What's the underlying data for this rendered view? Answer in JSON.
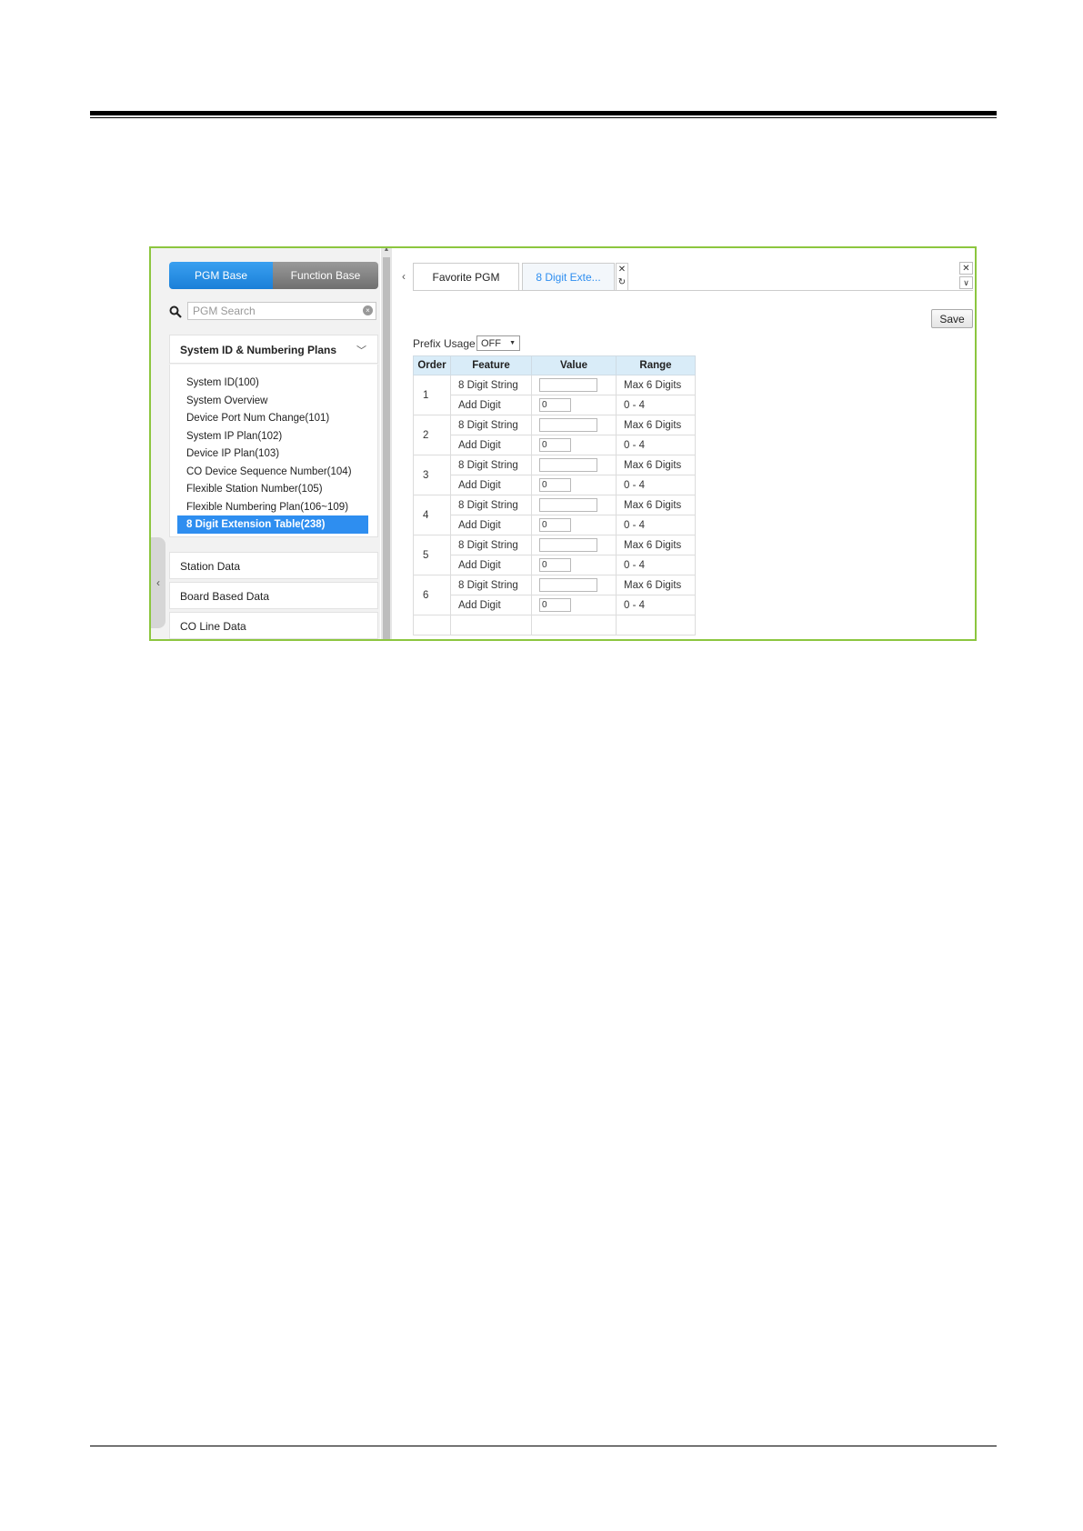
{
  "left_panel": {
    "toggle": {
      "active": "PGM Base",
      "inactive": "Function Base"
    },
    "search_placeholder": "PGM Search",
    "group_title": "System ID & Numbering Plans",
    "items": [
      "System ID(100)",
      "System Overview",
      "Device Port Num Change(101)",
      "System IP Plan(102)",
      "Device IP Plan(103)",
      "CO Device Sequence Number(104)",
      "Flexible Station Number(105)",
      "Flexible Numbering Plan(106~109)",
      "8 Digit Extension Table(238)"
    ],
    "selected_index": 8,
    "sections": [
      "Station Data",
      "Board Based Data",
      "CO Line Data"
    ]
  },
  "tabs": {
    "favorite": "Favorite PGM",
    "current": "8 Digit Exte..."
  },
  "save_label": "Save",
  "prefix": {
    "label": "Prefix Usage :",
    "value": "OFF"
  },
  "table": {
    "headers": [
      "Order",
      "Feature",
      "Value",
      "Range"
    ],
    "rows": [
      {
        "order": "1",
        "f1": "8 Digit String",
        "r1": "Max 6 Digits",
        "f2": "Add Digit",
        "v2": "0",
        "r2": "0 - 4"
      },
      {
        "order": "2",
        "f1": "8 Digit String",
        "r1": "Max 6 Digits",
        "f2": "Add Digit",
        "v2": "0",
        "r2": "0 - 4"
      },
      {
        "order": "3",
        "f1": "8 Digit String",
        "r1": "Max 6 Digits",
        "f2": "Add Digit",
        "v2": "0",
        "r2": "0 - 4"
      },
      {
        "order": "4",
        "f1": "8 Digit String",
        "r1": "Max 6 Digits",
        "f2": "Add Digit",
        "v2": "0",
        "r2": "0 - 4"
      },
      {
        "order": "5",
        "f1": "8 Digit String",
        "r1": "Max 6 Digits",
        "f2": "Add Digit",
        "v2": "0",
        "r2": "0 - 4"
      },
      {
        "order": "6",
        "f1": "8 Digit String",
        "r1": "Max 6 Digits",
        "f2": "Add Digit",
        "v2": "0",
        "r2": "0 - 4"
      }
    ]
  },
  "colors": {
    "accent": "#2e8ef0",
    "frame": "#8cc63f",
    "header_bg": "#d9ecf8"
  }
}
